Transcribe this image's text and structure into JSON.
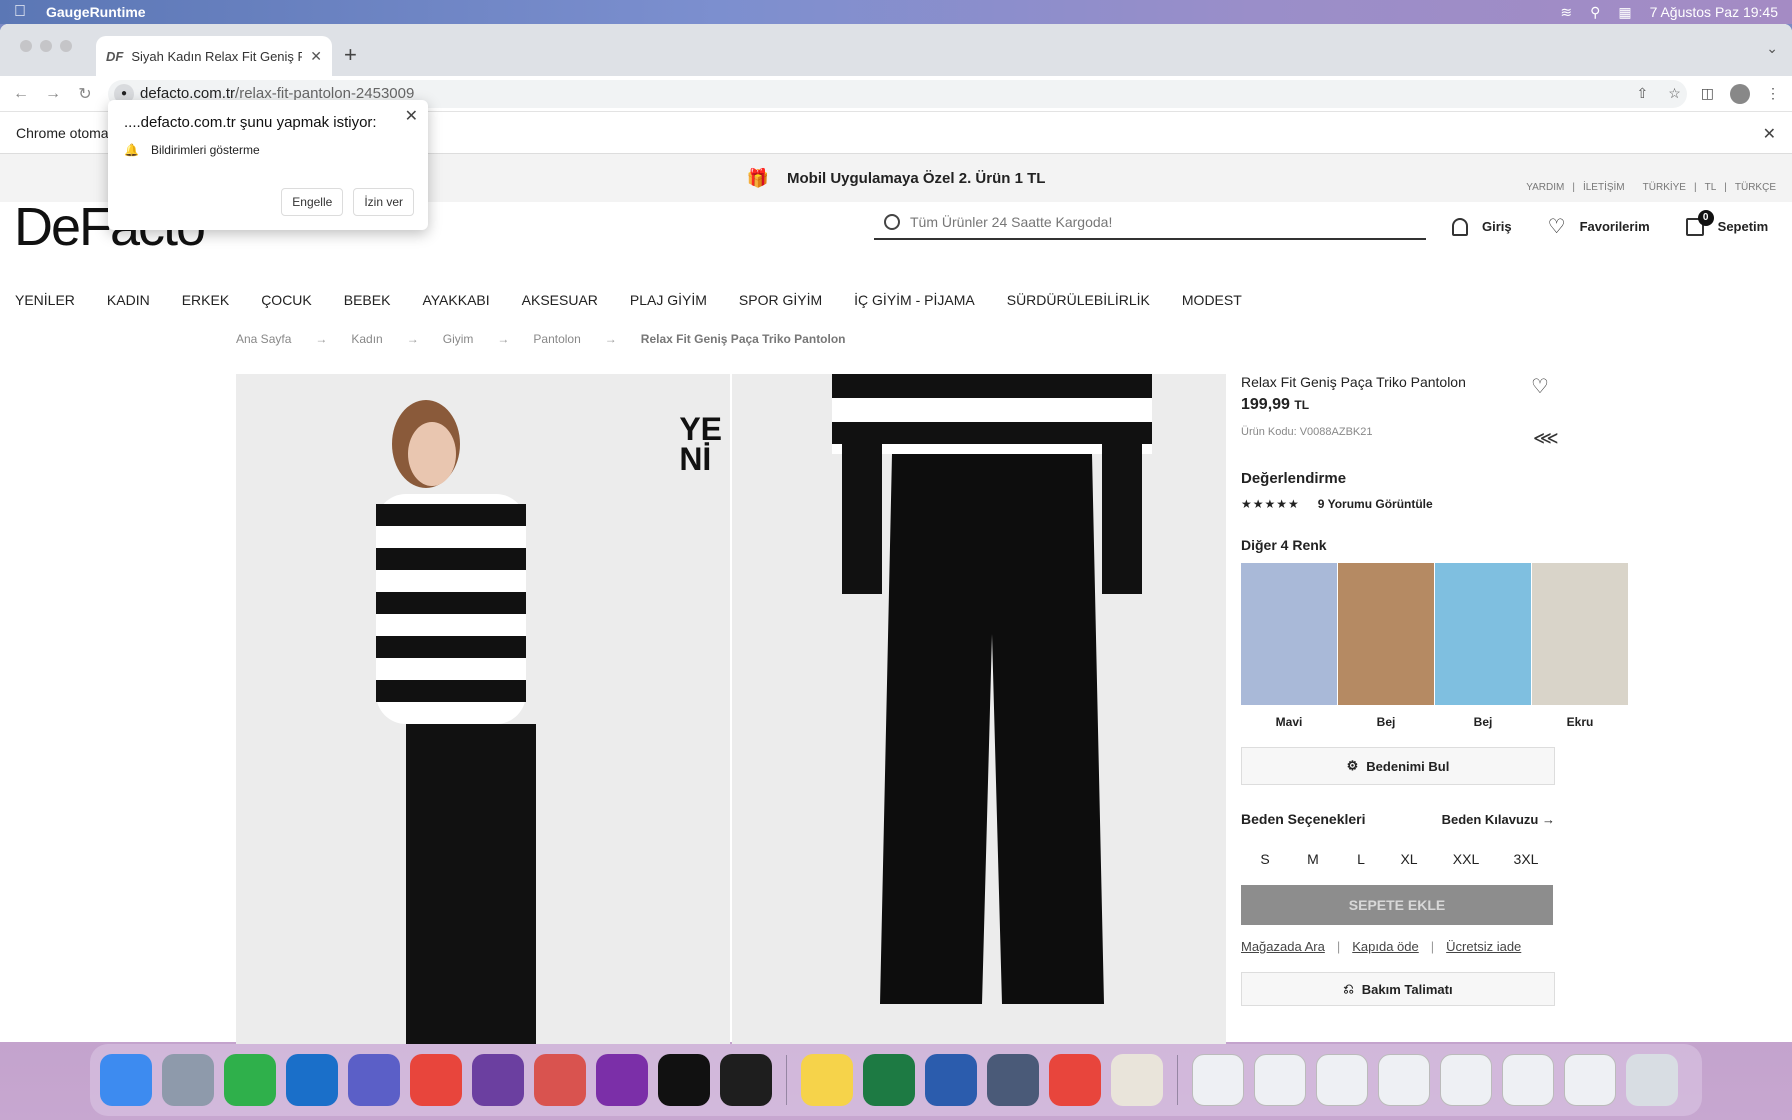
{
  "menubar": {
    "app_name": "GaugeRuntime",
    "datetime": "7 Ağustos Paz  19:45"
  },
  "browser": {
    "tab_favicon": "DF",
    "tab_title": "Siyah Kadın Relax Fit Geniş Pa",
    "url_domain": "defacto.com.tr",
    "url_path": "/relax-fit-pantolon-2453009",
    "infobar_text": "Chrome otomat"
  },
  "permission_popup": {
    "title": "....defacto.com.tr şunu yapmak istiyor:",
    "request": "Bildirimleri gösterme",
    "block_label": "Engelle",
    "allow_label": "İzin ver"
  },
  "promo": {
    "text": "Mobil Uygulamaya Özel 2. Ürün 1 TL"
  },
  "toplinks": [
    "YARDIM",
    "|",
    "İLETİŞİM",
    "TÜRKİYE",
    "|",
    "TL",
    "|",
    "TÜRKÇE"
  ],
  "header": {
    "logo": "DeFacto",
    "search_placeholder": "Tüm Ürünler 24 Saatte Kargoda!",
    "login": "Giriş",
    "favorites": "Favorilerim",
    "cart": "Sepetim",
    "cart_count": "0"
  },
  "categories": [
    "YENİLER",
    "KADIN",
    "ERKEK",
    "ÇOCUK",
    "BEBEK",
    "AYAKKABI",
    "AKSESUAR",
    "PLAJ GİYİM",
    "SPOR GİYİM",
    "İÇ GİYİM - PİJAMA",
    "SÜRDÜRÜLEBİLİRLİK",
    "MODEST"
  ],
  "breadcrumb": [
    "Ana Sayfa",
    "Kadın",
    "Giyim",
    "Pantolon",
    "Relax Fit Geniş Paça Triko Pantolon"
  ],
  "gallery": {
    "badge_line1": "YE",
    "badge_line2": "Nİ"
  },
  "product": {
    "name": "Relax Fit Geniş Paça Triko Pantolon",
    "price": "199,99",
    "currency": "TL",
    "sku": "Ürün Kodu: V0088AZBK21",
    "rating_title": "Değerlendirme",
    "stars": "★★★★★",
    "reviews_link": "9 Yorumu Görüntüle",
    "colors_title": "Diğer 4 Renk",
    "colors": [
      {
        "label": "Mavi",
        "color": "#a9b9d8"
      },
      {
        "label": "Bej",
        "color": "#b58a63"
      },
      {
        "label": "Bej",
        "color": "#7fbfe0"
      },
      {
        "label": "Ekru",
        "color": "#d9d4c9"
      }
    ],
    "find_size": "Bedenimi Bul",
    "size_title": "Beden Seçenekleri",
    "size_guide": "Beden Kılavuzu",
    "sizes": [
      "S",
      "M",
      "L",
      "XL",
      "XXL",
      "3XL"
    ],
    "add_to_cart": "SEPETE EKLE",
    "links": [
      "Mağazada Ara",
      "Kapıda öde",
      "Ücretsiz iade"
    ],
    "care": "Bakım Talimatı"
  },
  "dock_apps": [
    {
      "name": "Finder",
      "color": "#3d8bf0"
    },
    {
      "name": "Launchpad",
      "color": "#8e9aab"
    },
    {
      "name": "GaugeRuntime",
      "color": "#2fb04b"
    },
    {
      "name": "Outlook",
      "color": "#1a6fc9"
    },
    {
      "name": "Teams",
      "color": "#5b5fc7"
    },
    {
      "name": "Chrome",
      "color": "#e8453c"
    },
    {
      "name": "Screen Recorder",
      "color": "#6b3fa0"
    },
    {
      "name": "Preview",
      "color": "#d9534f"
    },
    {
      "name": "OneNote",
      "color": "#7b2fa8"
    },
    {
      "name": "IntelliJ",
      "color": "#111111"
    },
    {
      "name": "Terminal",
      "color": "#1e1e1e"
    },
    {
      "name": "Notes",
      "color": "#f6d34a"
    },
    {
      "name": "Excel",
      "color": "#1d7a43"
    },
    {
      "name": "Word",
      "color": "#2b5cad"
    },
    {
      "name": "Camo",
      "color": "#4a5a78"
    },
    {
      "name": "Chrome",
      "color": "#e8453c"
    },
    {
      "name": "Java",
      "color": "#e9e4da"
    }
  ]
}
